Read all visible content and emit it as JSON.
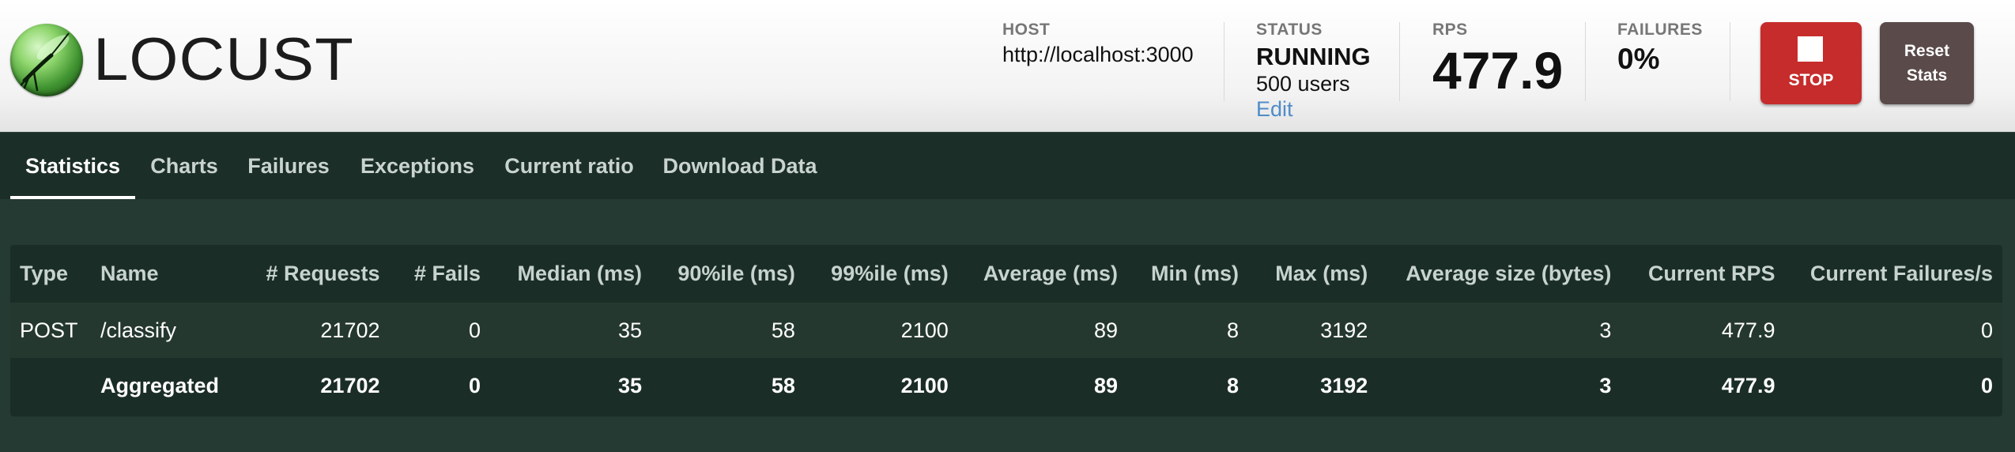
{
  "app": {
    "logo_text": "LOCUST"
  },
  "header": {
    "host_label": "HOST",
    "host_value": "http://localhost:3000",
    "status_label": "STATUS",
    "status_value": "RUNNING",
    "users_value": "500 users",
    "edit_label": "Edit",
    "rps_label": "RPS",
    "rps_value": "477.9",
    "failures_label": "FAILURES",
    "failures_value": "0%",
    "stop_label": "STOP",
    "reset_line1": "Reset",
    "reset_line2": "Stats"
  },
  "tabs": [
    {
      "label": "Statistics",
      "active": true
    },
    {
      "label": "Charts"
    },
    {
      "label": "Failures"
    },
    {
      "label": "Exceptions"
    },
    {
      "label": "Current ratio"
    },
    {
      "label": "Download Data"
    }
  ],
  "table": {
    "columns": [
      "Type",
      "Name",
      "# Requests",
      "# Fails",
      "Median (ms)",
      "90%ile (ms)",
      "99%ile (ms)",
      "Average (ms)",
      "Min (ms)",
      "Max (ms)",
      "Average size (bytes)",
      "Current RPS",
      "Current Failures/s"
    ],
    "rows": [
      [
        "POST",
        "/classify",
        "21702",
        "0",
        "35",
        "58",
        "2100",
        "89",
        "8",
        "3192",
        "3",
        "477.9",
        "0"
      ],
      [
        "",
        "Aggregated",
        "21702",
        "0",
        "35",
        "58",
        "2100",
        "89",
        "8",
        "3192",
        "3",
        "477.9",
        "0"
      ]
    ]
  },
  "colors": {
    "stop_button": "#c62c2c",
    "reset_button": "#5a4a4a",
    "edit_link": "#4f8cc9",
    "page_background": "#243a33"
  }
}
